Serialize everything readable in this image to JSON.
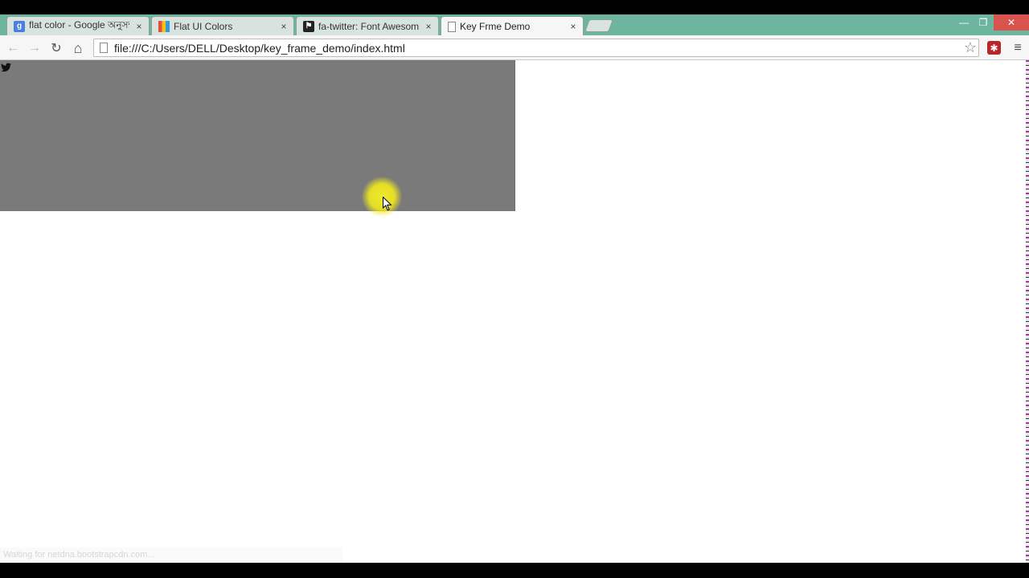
{
  "browser": {
    "tabs": [
      {
        "title": "flat color - Google অনুসন্ধান",
        "icon": "google-icon",
        "active": false
      },
      {
        "title": "Flat UI Colors",
        "icon": "flat-ui-colors-icon",
        "active": false
      },
      {
        "title": "fa-twitter: Font Awesome",
        "icon": "font-awesome-icon",
        "active": false
      },
      {
        "title": "Key Frme Demo",
        "icon": "page-icon",
        "active": true
      }
    ],
    "close_glyph": "×",
    "window_controls": {
      "minimize": "—",
      "restore": "❐",
      "close": "✕"
    },
    "nav": {
      "back": "←",
      "forward": "→",
      "reload": "↻",
      "home": "⌂"
    },
    "address_bar": {
      "value": "file:///C:/Users/DELL/Desktop/key_frame_demo/index.html"
    },
    "bookmark_star": "☆",
    "extension_glyph": "✱",
    "menu_glyph": "≡",
    "status_text": "Waiting for netdna.bootstrapcdn.com..."
  },
  "colors": {
    "titlebar": "#6db59f",
    "gray_box": "#7a7a7a",
    "cursor_highlight": "#f5f028",
    "close_button": "#d9534f",
    "extension": "#b8262b"
  },
  "page": {
    "icon": "twitter-icon"
  }
}
